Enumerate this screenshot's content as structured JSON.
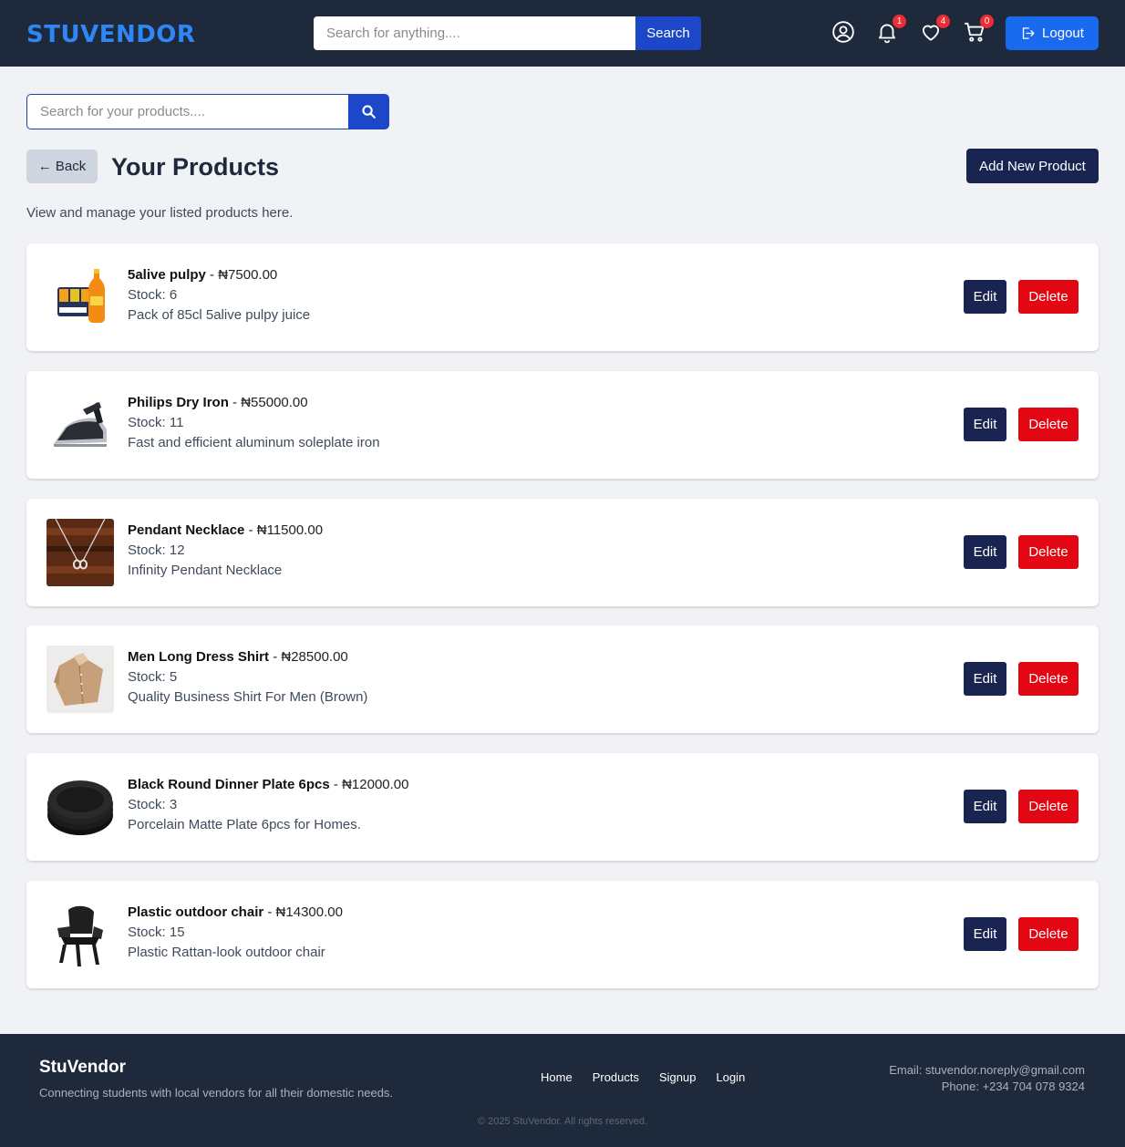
{
  "header": {
    "brand": "STUVENDOR",
    "search_placeholder": "Search for anything....",
    "search_button": "Search",
    "notifications_count": "1",
    "wishlist_count": "4",
    "cart_count": "0",
    "logout_label": "Logout",
    "accent_color": "#2f86f6"
  },
  "toolbar": {
    "search_placeholder": "Search for your products....",
    "back_label": "← Back",
    "title": "Your Products",
    "add_button": "Add New Product",
    "subtitle": "View and manage your listed products here."
  },
  "products": [
    {
      "name": "5alive pulpy",
      "price": "₦7500.00",
      "stock": "Stock: 6",
      "description": "Pack of 85cl 5alive pulpy juice",
      "image": "juice-pack-image"
    },
    {
      "name": "Philips Dry Iron",
      "price": "₦55000.00",
      "stock": "Stock: 11",
      "description": "Fast and efficient aluminum soleplate iron",
      "image": "dry-iron-image"
    },
    {
      "name": "Pendant Necklace",
      "price": "₦11500.00",
      "stock": "Stock: 12",
      "description": "Infinity Pendant Necklace",
      "image": "necklace-image"
    },
    {
      "name": "Men Long Dress Shirt",
      "price": "₦28500.00",
      "stock": "Stock: 5",
      "description": "Quality Business Shirt For Men (Brown)",
      "image": "shirt-image"
    },
    {
      "name": "Black Round Dinner Plate 6pcs",
      "price": "₦12000.00",
      "stock": "Stock: 3",
      "description": "Porcelain Matte Plate 6pcs for Homes.",
      "image": "plates-image"
    },
    {
      "name": "Plastic outdoor chair",
      "price": "₦14300.00",
      "stock": "Stock: 15",
      "description": "Plastic Rattan-look outdoor chair",
      "image": "chair-image"
    }
  ],
  "actions": {
    "edit": "Edit",
    "delete": "Delete"
  },
  "footer": {
    "brand": "StuVendor",
    "tagline": "Connecting students with local vendors for all their domestic needs.",
    "links": [
      "Home",
      "Products",
      "Signup",
      "Login"
    ],
    "email": "Email: stuvendor.noreply@gmail.com",
    "phone": "Phone: +234 704 078 9324",
    "copyright": "© 2025 StuVendor. All rights reserved."
  }
}
